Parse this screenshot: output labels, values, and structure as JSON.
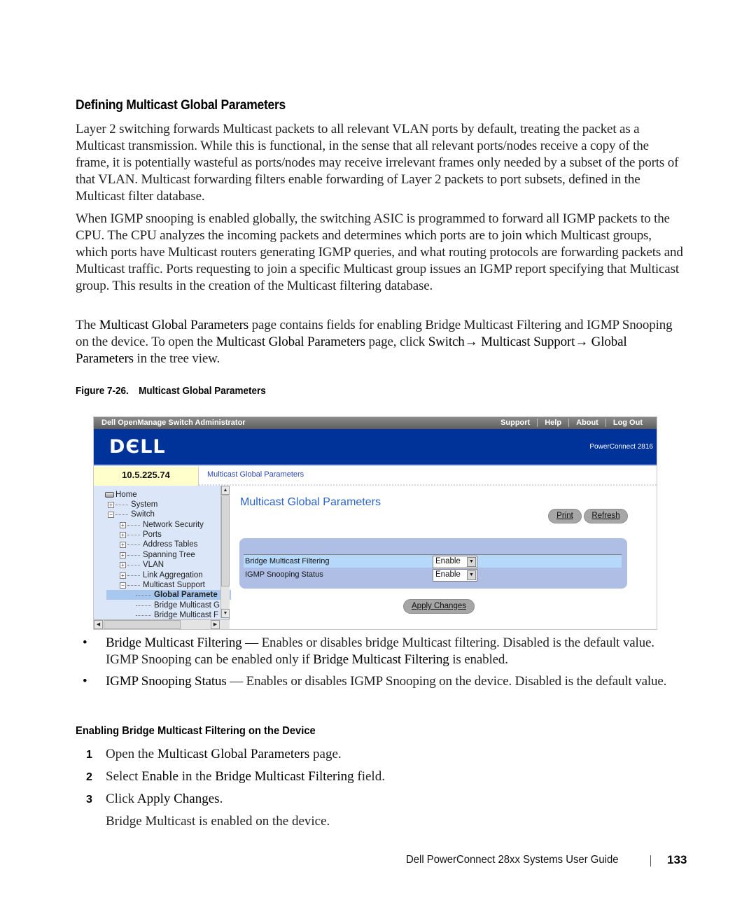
{
  "section_heading": "Defining Multicast Global Parameters",
  "paragraphs": {
    "p1": "Layer 2 switching forwards Multicast packets to all relevant VLAN ports by default, treating the packet as a Multicast transmission. While this is functional, in the sense that all relevant ports/nodes receive a copy of the frame, it is potentially wasteful as ports/nodes may receive irrelevant frames only needed by a subset of the ports of that VLAN. Multicast forwarding filters enable forwarding of Layer 2 packets to port subsets, defined in the Multicast filter database.",
    "p2": "When IGMP snooping is enabled globally, the switching ASIC is programmed to forward all IGMP packets to the CPU. The CPU analyzes the incoming packets and determines which ports are to join which Multicast groups, which ports have Multicast routers generating IGMP queries, and what routing protocols are forwarding packets and Multicast traffic. Ports requesting to join a specific Multicast group issues an IGMP report specifying that Multicast group. This results in the creation of the Multicast filtering database.",
    "p3": {
      "t1": "The ",
      "b1": "Multicast Global Parameters",
      "t2": " page contains fields for enabling Bridge Multicast Filtering and IGMP Snooping on the device. To open the ",
      "b2": "Multicast Global Parameters",
      "t3": " page, click ",
      "b3": "Switch→ Multicast Support→ Global Parameters",
      "t4": " in the tree view."
    }
  },
  "figure": {
    "caption_number": "Figure 7-26.",
    "caption_title": "Multicast Global Parameters"
  },
  "screenshot": {
    "app_title": "Dell OpenManage Switch Administrator",
    "top_links": [
      "Support",
      "Help",
      "About",
      "Log Out"
    ],
    "logo": "DЄLL",
    "model": "PowerConnect 2816",
    "ip_address": "10.5.225.74",
    "breadcrumb": "Multicast Global Parameters",
    "tree": {
      "home": "Home",
      "items": [
        {
          "label": "System",
          "toggle": "+"
        },
        {
          "label": "Switch",
          "toggle": "−"
        },
        {
          "label": "Network Security",
          "toggle": "+"
        },
        {
          "label": "Ports",
          "toggle": "+"
        },
        {
          "label": "Address Tables",
          "toggle": "+"
        },
        {
          "label": "Spanning Tree",
          "toggle": "+"
        },
        {
          "label": "VLAN",
          "toggle": "+"
        },
        {
          "label": "Link Aggregation",
          "toggle": "+"
        },
        {
          "label": "Multicast Support",
          "toggle": "−"
        },
        {
          "label": "Global Paramete",
          "selected": true
        },
        {
          "label": "Bridge Multicast G"
        },
        {
          "label": "Bridge Multicast F"
        }
      ]
    },
    "page_title": "Multicast Global Parameters",
    "buttons": {
      "print": "Print",
      "refresh": "Refresh",
      "apply": "Apply Changes"
    },
    "fields": [
      {
        "label": "Bridge Multicast Filtering",
        "value": "Enable"
      },
      {
        "label": "IGMP Snooping Status",
        "value": "Enable"
      }
    ]
  },
  "bullets": [
    {
      "term": "Bridge Multicast Filtering",
      "text1": " — Enables or disables bridge Multicast filtering. Disabled is the default value. IGMP Snooping can be enabled only if ",
      "bold2": "Bridge Multicast Filtering",
      "text2": " is enabled."
    },
    {
      "term": "IGMP Snooping Status",
      "text1": " — Enables or disables IGMP Snooping on the device. Disabled is the default value."
    }
  ],
  "subheading": "Enabling Bridge Multicast Filtering on the Device",
  "steps": [
    {
      "num": "1",
      "t1": "Open the ",
      "b1": "Multicast Global Parameters",
      "t2": " page."
    },
    {
      "num": "2",
      "t1": "Select ",
      "b1": "Enable",
      "t2": " in the ",
      "b2": "Bridge Multicast Filtering",
      "t3": " field."
    },
    {
      "num": "3",
      "t1": "Click ",
      "b1": "Apply Changes",
      "t2": "."
    }
  ],
  "result_note": "Bridge Multicast is enabled on the device.",
  "footer": {
    "guide_title": "Dell PowerConnect 28xx Systems User Guide",
    "page_number": "133"
  }
}
